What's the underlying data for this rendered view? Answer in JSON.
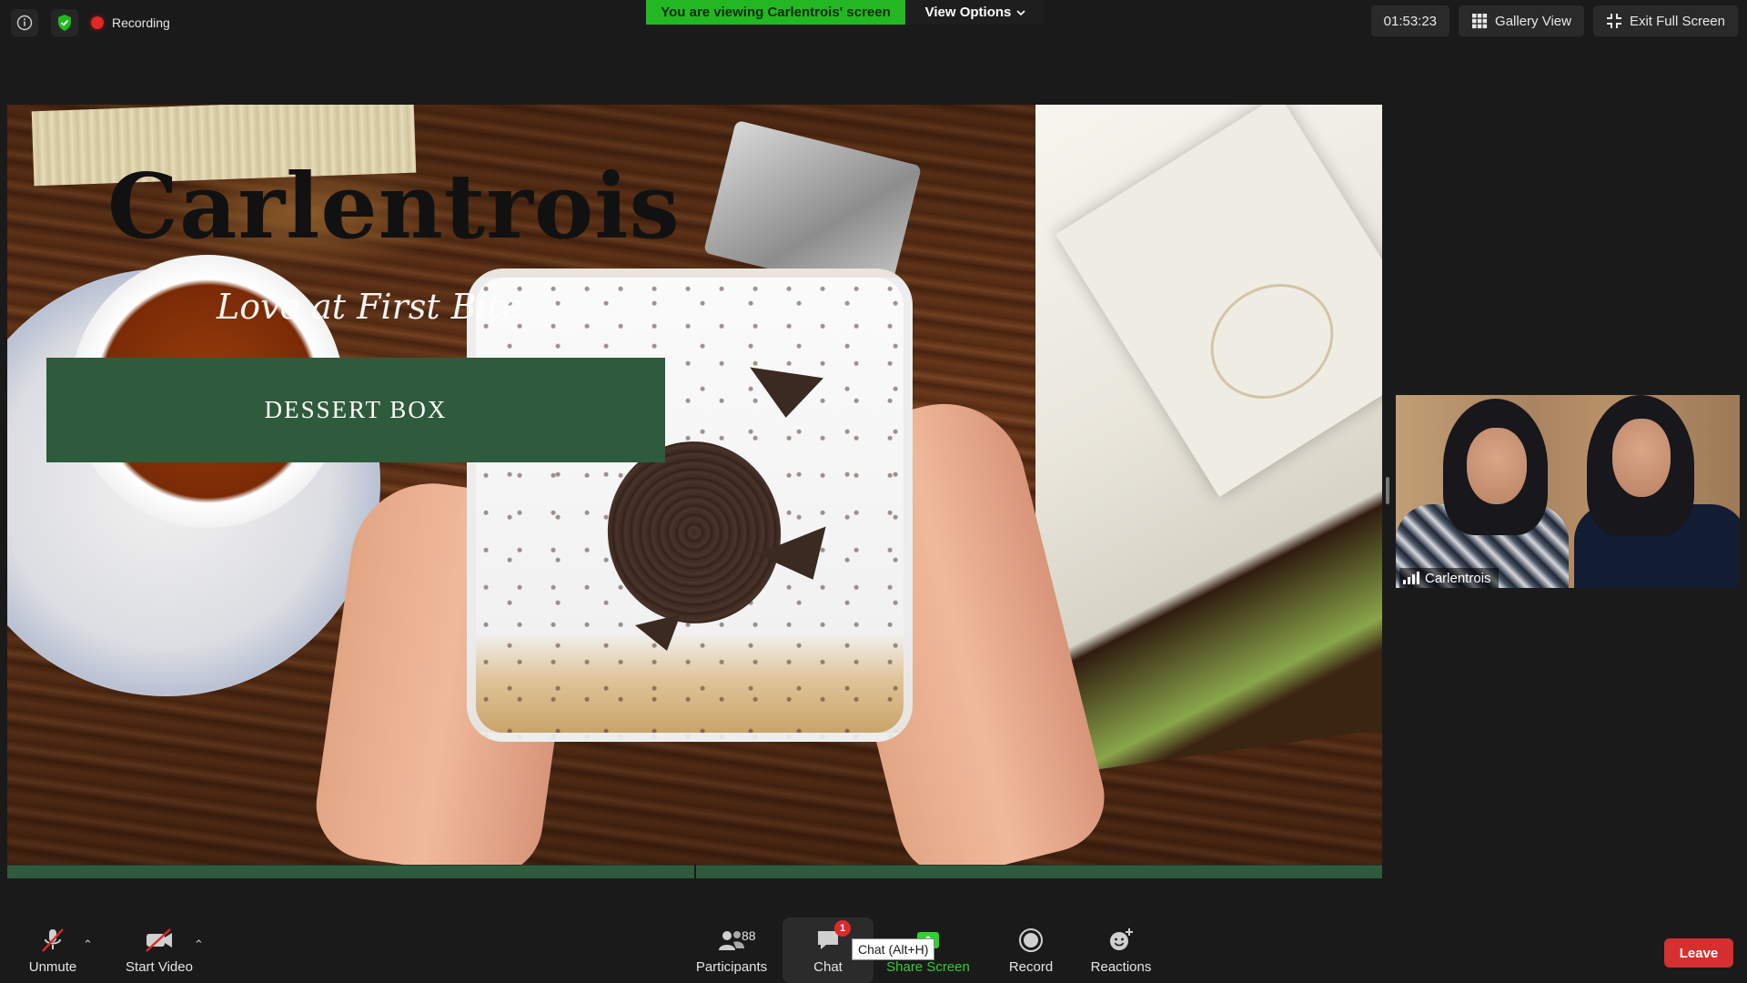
{
  "top_bar": {
    "info_icon": "info-icon",
    "security_icon": "shield-check-icon",
    "recording_label": "Recording",
    "viewing_banner": "You are viewing Carlentrois' screen",
    "view_options_label": "View Options",
    "timer": "01:53:23",
    "gallery_view_label": "Gallery View",
    "exit_full_screen_label": "Exit Full Screen"
  },
  "shared_slide": {
    "brand_title": "Carlentrois",
    "tagline": "Love at First Bite",
    "product_label": "DESSERT BOX"
  },
  "participant": {
    "name": "Carlentrois"
  },
  "toolbar": {
    "unmute_label": "Unmute",
    "start_video_label": "Start Video",
    "participants_label": "Participants",
    "participants_count": "88",
    "chat_label": "Chat",
    "chat_badge": "1",
    "chat_tooltip": "Chat (Alt+H)",
    "share_screen_label": "Share Screen",
    "record_label": "Record",
    "reactions_label": "Reactions",
    "leave_label": "Leave"
  },
  "colors": {
    "app_background": "#1a1a1a",
    "viewing_banner_green": "#23b823",
    "slide_banner_green": "#2e5b3c",
    "recording_red": "#e02828",
    "leave_red": "#d62f2f",
    "share_screen_green": "#2fd02f"
  }
}
